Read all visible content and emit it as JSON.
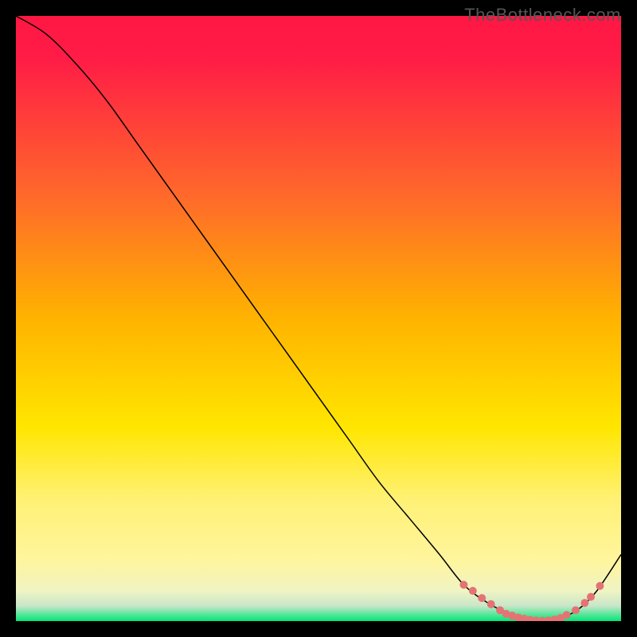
{
  "watermark": "TheBottleneck.com",
  "chart_data": {
    "type": "line",
    "title": "",
    "xlabel": "",
    "ylabel": "",
    "xlim": [
      0,
      100
    ],
    "ylim": [
      0,
      100
    ],
    "grid": false,
    "legend": false,
    "background_gradient": {
      "stops": [
        {
          "offset": 0.0,
          "color": "#ff1744"
        },
        {
          "offset": 0.07,
          "color": "#ff1c46"
        },
        {
          "offset": 0.3,
          "color": "#ff6a2a"
        },
        {
          "offset": 0.5,
          "color": "#ffb300"
        },
        {
          "offset": 0.68,
          "color": "#ffe600"
        },
        {
          "offset": 0.8,
          "color": "#fff176"
        },
        {
          "offset": 0.9,
          "color": "#fff59d"
        },
        {
          "offset": 0.95,
          "color": "#f0f4c3"
        },
        {
          "offset": 0.975,
          "color": "#c8e6c9"
        },
        {
          "offset": 1.0,
          "color": "#00e676"
        }
      ]
    },
    "series": [
      {
        "name": "bottleneck-curve",
        "stroke": "#000000",
        "stroke_width": 1.5,
        "x": [
          0,
          5,
          10,
          15,
          20,
          25,
          30,
          35,
          40,
          45,
          50,
          55,
          60,
          65,
          70,
          74,
          78,
          82,
          86,
          90,
          93,
          96,
          100
        ],
        "y": [
          100,
          97,
          92,
          86,
          79,
          72,
          65,
          58,
          51,
          44,
          37,
          30,
          23,
          17,
          11,
          6,
          3,
          1,
          0,
          0.5,
          2,
          5,
          11
        ]
      }
    ],
    "markers": {
      "name": "highlight-dots",
      "color": "#e57373",
      "radius": 5,
      "points": [
        {
          "x": 74,
          "y": 6
        },
        {
          "x": 75.5,
          "y": 5
        },
        {
          "x": 77,
          "y": 3.8
        },
        {
          "x": 78.5,
          "y": 2.8
        },
        {
          "x": 80,
          "y": 1.8
        },
        {
          "x": 81,
          "y": 1.2
        },
        {
          "x": 82,
          "y": 0.9
        },
        {
          "x": 83,
          "y": 0.6
        },
        {
          "x": 84,
          "y": 0.4
        },
        {
          "x": 85,
          "y": 0.2
        },
        {
          "x": 86,
          "y": 0.1
        },
        {
          "x": 87,
          "y": 0.05
        },
        {
          "x": 88,
          "y": 0.1
        },
        {
          "x": 89,
          "y": 0.25
        },
        {
          "x": 90,
          "y": 0.5
        },
        {
          "x": 91,
          "y": 1.0
        },
        {
          "x": 92.5,
          "y": 1.8
        },
        {
          "x": 94,
          "y": 3.0
        },
        {
          "x": 95,
          "y": 4.0
        },
        {
          "x": 96.5,
          "y": 5.8
        }
      ]
    }
  }
}
